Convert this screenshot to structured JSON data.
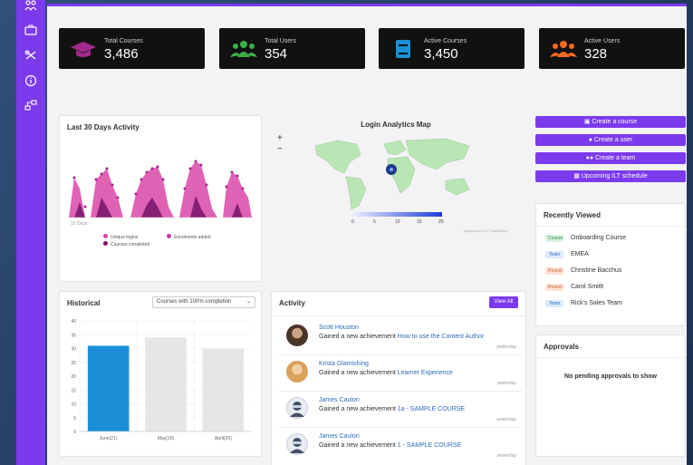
{
  "stats": [
    {
      "label": "Total Courses",
      "value": "3,486",
      "icon": "graduation-cap-icon",
      "color": "#a3298d"
    },
    {
      "label": "Total Users",
      "value": "354",
      "icon": "users-icon",
      "color": "#3fae49"
    },
    {
      "label": "Active Courses",
      "value": "3,450",
      "icon": "book-icon",
      "color": "#1b8fd2"
    },
    {
      "label": "Active Users",
      "value": "328",
      "icon": "users-icon",
      "color": "#f26b21"
    }
  ],
  "activity": {
    "title": "Last 30 Days Activity",
    "legend": [
      "Unique logins",
      "Enrolments added",
      "Courses completed"
    ],
    "xlabel": "15 Days"
  },
  "map": {
    "title": "Login Analytics Map",
    "zoom_in": "+",
    "zoom_out": "−",
    "scale": [
      "0",
      "5",
      "10",
      "15",
      "20"
    ],
    "attribution": "Appsource.io © DataTables"
  },
  "actions": [
    {
      "label": "Create a course",
      "icon": "course-icon"
    },
    {
      "label": "Create a user",
      "icon": "user-icon"
    },
    {
      "label": "Create a team",
      "icon": "team-icon"
    },
    {
      "label": "Upcoming ILT schedule",
      "icon": "calendar-icon"
    }
  ],
  "recently_viewed": {
    "title": "Recently Viewed",
    "items": [
      {
        "tag": "Course",
        "type": "course",
        "name": "Onboarding Course"
      },
      {
        "tag": "Team",
        "type": "team",
        "name": "EMEA"
      },
      {
        "tag": "Person",
        "type": "person",
        "name": "Christine Bacchus"
      },
      {
        "tag": "Person",
        "type": "person",
        "name": "Carol Smith"
      },
      {
        "tag": "Team",
        "type": "team",
        "name": "Rick's Sales Team"
      }
    ]
  },
  "historical": {
    "title": "Historical",
    "filter": "Courses with 100% completion"
  },
  "chart_data": {
    "type": "bar",
    "categories": [
      "June(21)",
      "May(20)",
      "April(20)"
    ],
    "values": [
      31,
      34,
      30
    ],
    "ylim": [
      0,
      40
    ],
    "yticks": [
      0,
      5,
      10,
      15,
      20,
      25,
      30,
      35,
      40
    ],
    "colors": [
      "#1a8fd8",
      "#e6e6e6",
      "#e6e6e6"
    ],
    "grid": true
  },
  "activity_feed": {
    "title": "Activity",
    "view_all": "View All",
    "items": [
      {
        "name": "Scott Houston",
        "text": "Gained a new achievement",
        "link": "How to use the Content Author",
        "time": "yesterday"
      },
      {
        "name": "Krista Glamishing",
        "text": "Gained a new achievement",
        "link": "Learner Experience",
        "time": "yesterday"
      },
      {
        "name": "James Caulon",
        "text": "Gained a new achievement",
        "link": "1a - SAMPLE COURSE",
        "time": "yesterday"
      },
      {
        "name": "James Caulon",
        "text": "Gained a new achievement",
        "link": "1 - SAMPLE COURSE",
        "time": "yesterday"
      }
    ]
  },
  "approvals": {
    "title": "Approvals",
    "empty": "No pending approvals to show"
  }
}
